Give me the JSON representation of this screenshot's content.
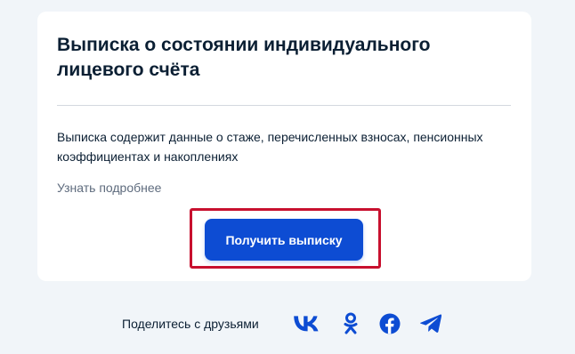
{
  "card": {
    "title": "Выписка о состоянии индивидуального лицевого счёта",
    "description": "Выписка содержит данные о стаже, перечисленных взносах, пенсионных коэффициентах и накоплениях",
    "more_link": "Узнать подробнее",
    "button_label": "Получить выписку"
  },
  "share": {
    "label": "Поделитесь с друзьями",
    "networks": [
      "vk-icon",
      "odnoklassniki-icon",
      "facebook-icon",
      "telegram-icon"
    ]
  },
  "colors": {
    "accent": "#0d4cd3",
    "highlight": "#c8102e",
    "icon": "#0d4cd3"
  }
}
